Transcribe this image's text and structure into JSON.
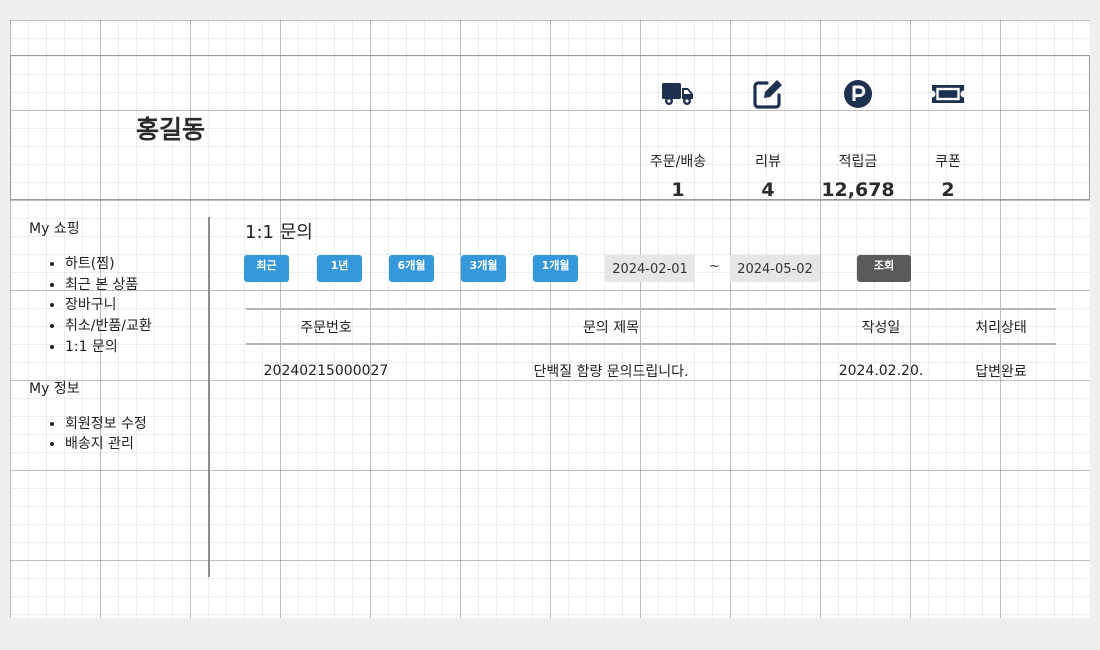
{
  "user": {
    "name": "홍길동"
  },
  "stats": [
    {
      "icon": "truck-icon",
      "label": "주문/배송",
      "value": "1"
    },
    {
      "icon": "edit-icon",
      "label": "리뷰",
      "value": "4"
    },
    {
      "icon": "points-icon",
      "label": "적립금",
      "value": "12,678"
    },
    {
      "icon": "ticket-icon",
      "label": "쿠폰",
      "value": "2"
    }
  ],
  "sidebar": {
    "shopping_title": "My 쇼핑",
    "shopping_items": [
      "하트(찜)",
      "최근 본 상품",
      "장바구니",
      "취소/반품/교환",
      "1:1 문의"
    ],
    "info_title": "My 정보",
    "info_items": [
      "회원정보 수정",
      "배송지 관리"
    ]
  },
  "main": {
    "title": "1:1 문의",
    "period_buttons": [
      "최근",
      "1년",
      "6개월",
      "3개월",
      "1개월"
    ],
    "date_from": "2024-02-01",
    "date_separator": "~",
    "date_to": "2024-05-02",
    "search_label": "조회",
    "table": {
      "headers": [
        "주문번호",
        "문의 제목",
        "작성일",
        "처리상태"
      ],
      "rows": [
        [
          "20240215000027",
          "단백질 함량 문의드립니다.",
          "2024.02.20.",
          "답변완료"
        ]
      ]
    }
  },
  "colors": {
    "icon": "#1e3050",
    "primary_button": "#3498db",
    "search_button": "#5a5a5a",
    "date_bg": "#e6e6e6"
  }
}
